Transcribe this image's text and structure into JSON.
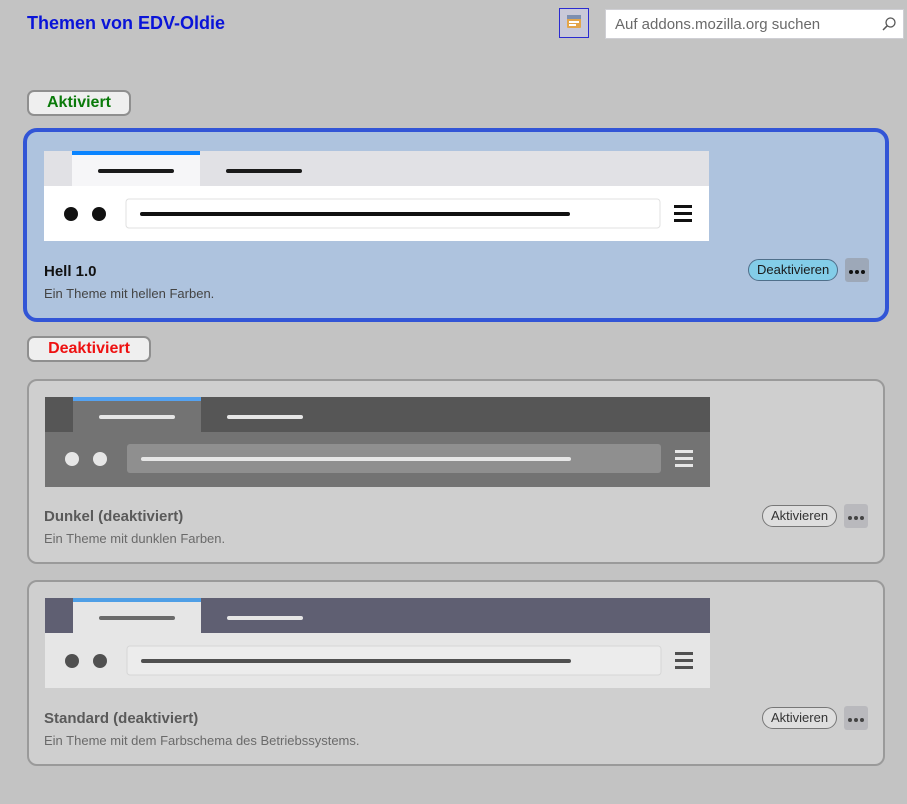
{
  "header": {
    "title": "Themen von EDV-Oldie",
    "search_placeholder": "Auf addons.mozilla.org suchen",
    "icons": [
      "themes-icon",
      "search-icon"
    ]
  },
  "sections": {
    "enabled_label": "Aktiviert",
    "disabled_label": "Deaktiviert",
    "enabled_color": "#0a7a0a",
    "disabled_color": "#ee1111"
  },
  "themes": [
    {
      "name": "Hell 1.0",
      "description": "Ein Theme mit hellen Farben.",
      "button": "Deaktivieren",
      "status": "active",
      "colors": {
        "frame": "#e1e1e5",
        "tab": "#f6f6f8",
        "toolbar": "#ffffff",
        "field": "#ffffff",
        "lines": "#1a1a1a",
        "accent": "#0a84ff"
      }
    },
    {
      "name": "Dunkel (deaktiviert)",
      "description": "Ein Theme mit dunklen Farben.",
      "button": "Aktivieren",
      "status": "disabled",
      "colors": {
        "frame": "#565656",
        "tab": "#737373",
        "toolbar": "#737373",
        "field": "#8f8f8f",
        "lines": "#e6e6e6",
        "accent": "#55a2f0"
      }
    },
    {
      "name": "Standard (deaktiviert)",
      "description": "Ein Theme mit dem Farbschema des Betriebssystems.",
      "button": "Aktivieren",
      "status": "disabled",
      "colors": {
        "frame": "#5f5f72",
        "tab": "#e6e6e6",
        "toolbar": "#e6e6e6",
        "field": "#ececec",
        "lines": "#505050",
        "accent": "#4f9fe6"
      }
    }
  ]
}
